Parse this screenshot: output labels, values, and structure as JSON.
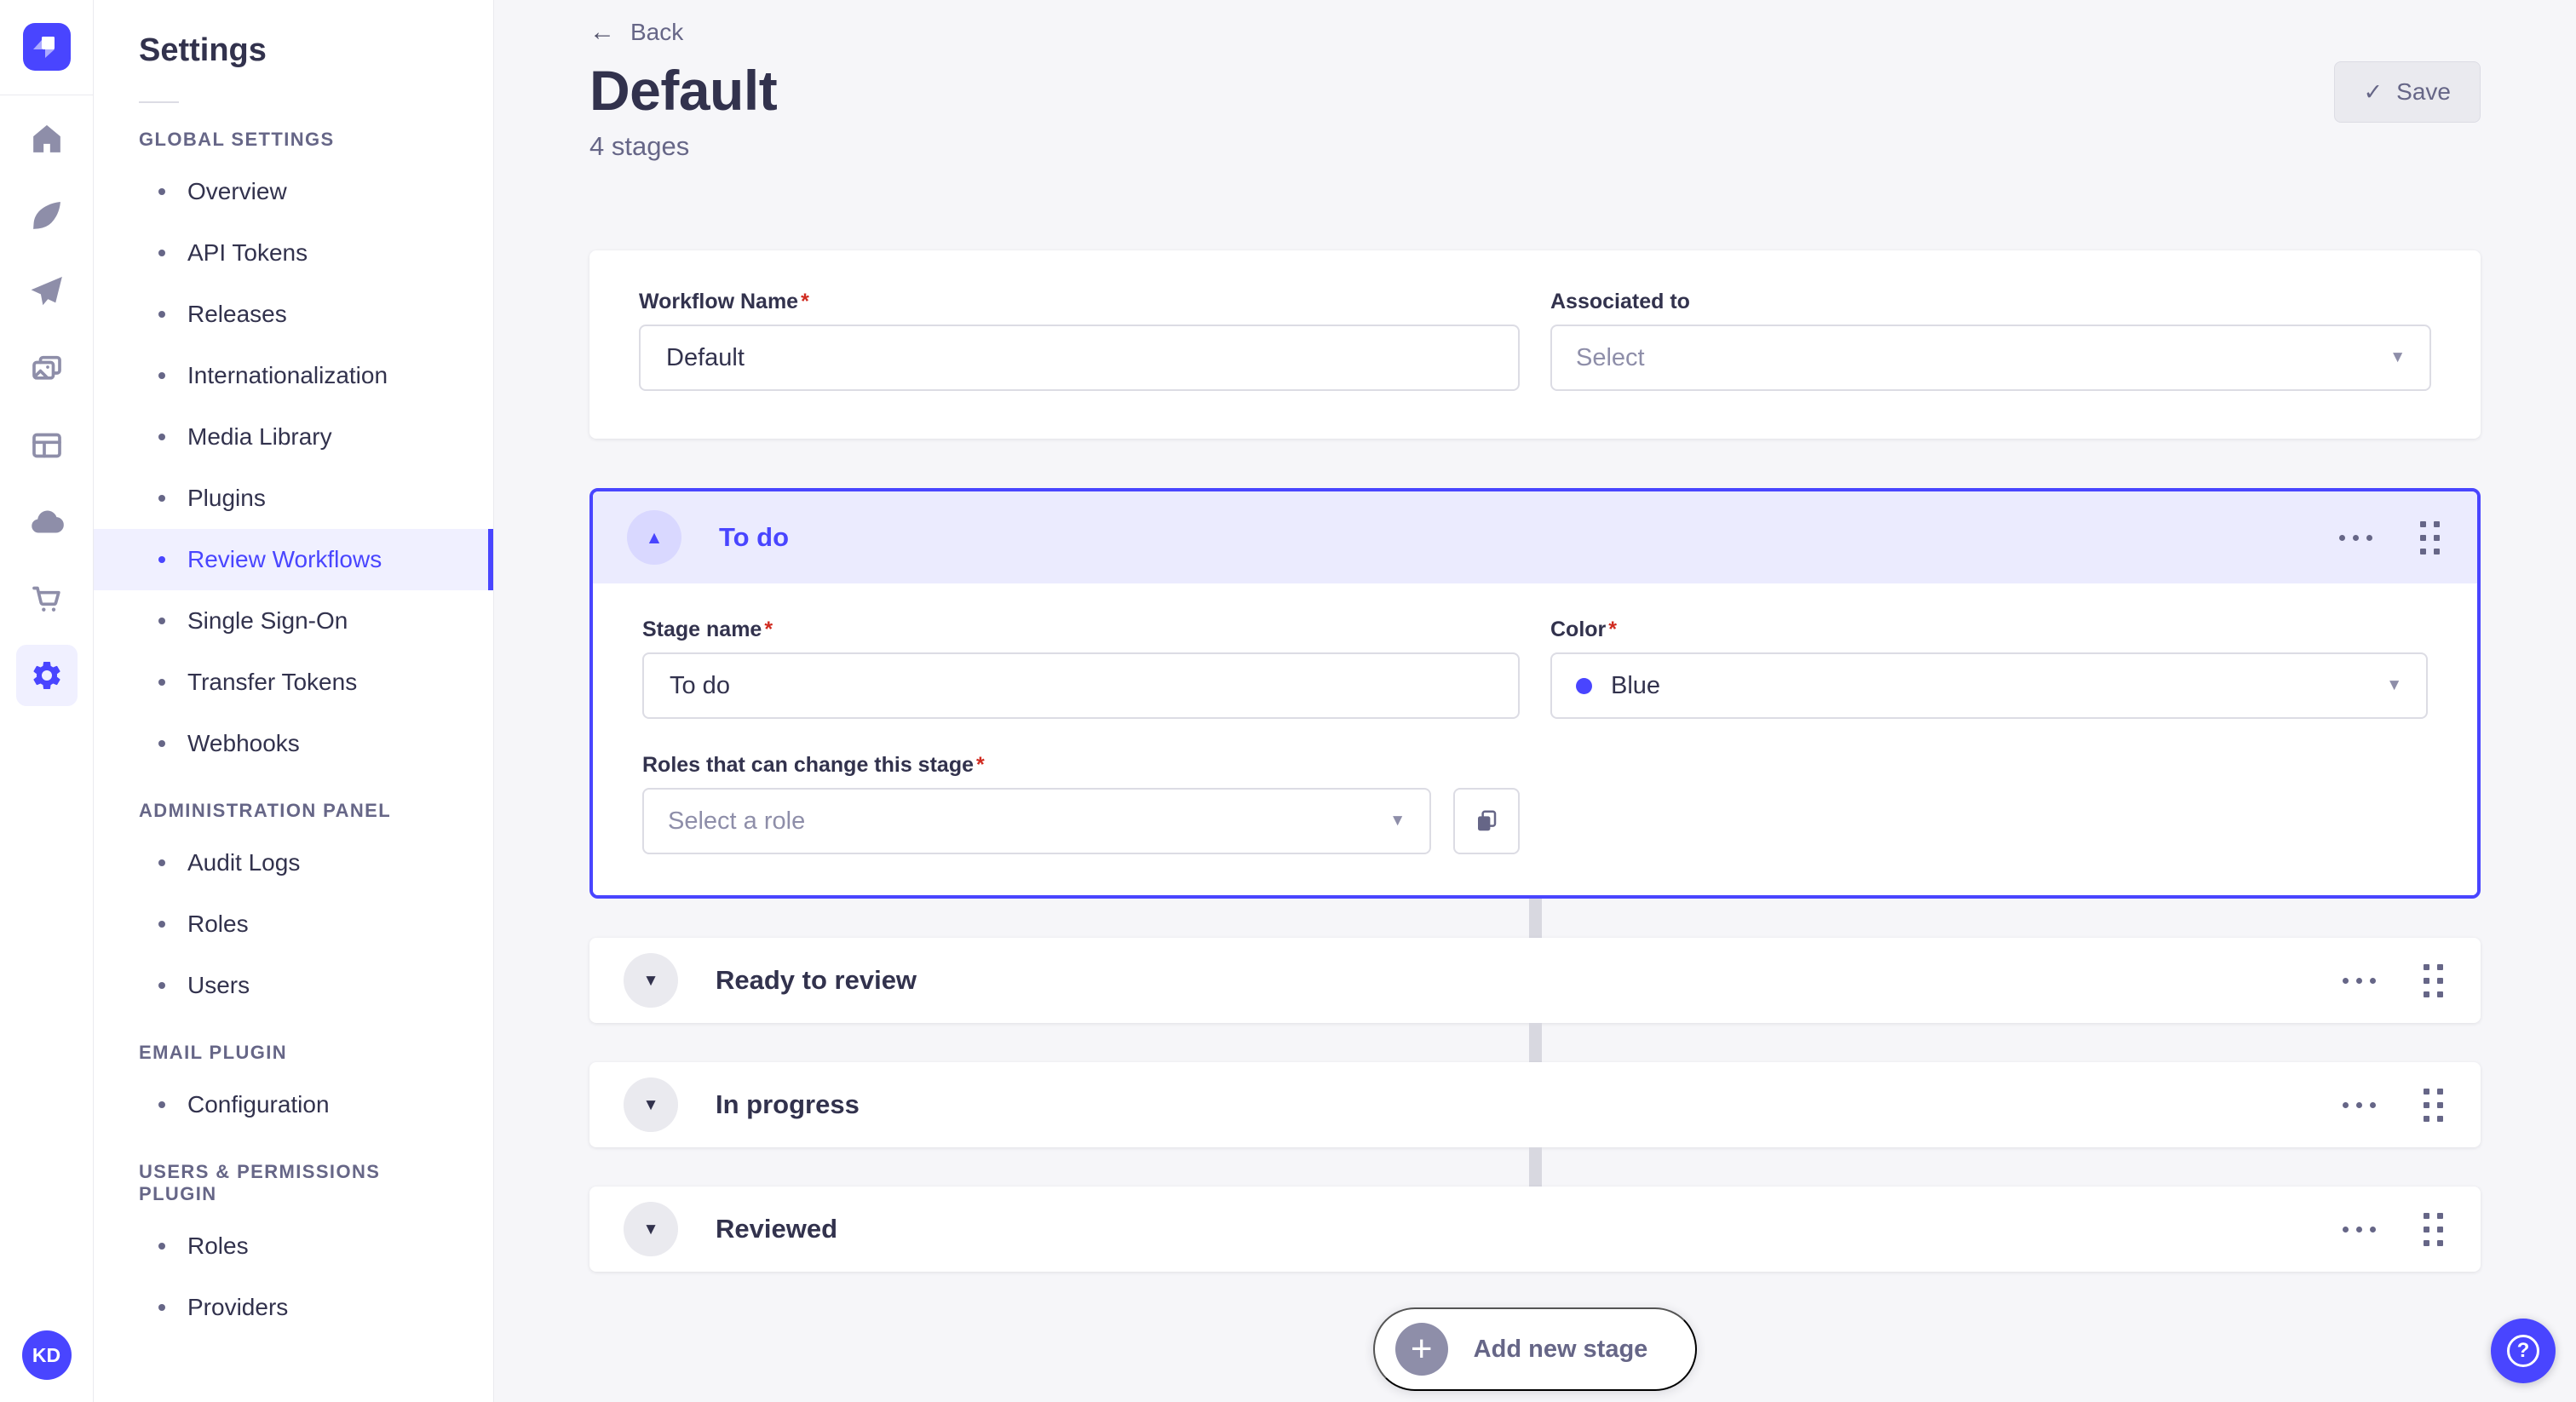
{
  "ui": {
    "required_mark": "*"
  },
  "icons": {
    "back_arrow": "←",
    "check": "✓",
    "caret_down": "▼",
    "collapse_up": "▲",
    "expand_down": "▼",
    "plus": "+",
    "help": "?"
  },
  "nav_rail": {
    "avatar_initials": "KD"
  },
  "sidebar": {
    "title": "Settings",
    "sections": [
      {
        "label": "GLOBAL SETTINGS",
        "items": [
          {
            "label": "Overview"
          },
          {
            "label": "API Tokens"
          },
          {
            "label": "Releases"
          },
          {
            "label": "Internationalization"
          },
          {
            "label": "Media Library"
          },
          {
            "label": "Plugins"
          },
          {
            "label": "Review Workflows",
            "active": true
          },
          {
            "label": "Single Sign-On"
          },
          {
            "label": "Transfer Tokens"
          },
          {
            "label": "Webhooks"
          }
        ]
      },
      {
        "label": "ADMINISTRATION PANEL",
        "items": [
          {
            "label": "Audit Logs"
          },
          {
            "label": "Roles"
          },
          {
            "label": "Users"
          }
        ]
      },
      {
        "label": "EMAIL PLUGIN",
        "items": [
          {
            "label": "Configuration"
          }
        ]
      },
      {
        "label": "USERS & PERMISSIONS PLUGIN",
        "items": [
          {
            "label": "Roles"
          },
          {
            "label": "Providers"
          }
        ]
      }
    ]
  },
  "header": {
    "back_label": "Back",
    "title": "Default",
    "subtitle": "4 stages",
    "save_label": "Save"
  },
  "workflow": {
    "name_label": "Workflow Name",
    "name_value": "Default",
    "associated_label": "Associated to",
    "associated_placeholder": "Select"
  },
  "stage_form": {
    "stage_name_label": "Stage name",
    "stage_name_value": "To do",
    "color_label": "Color",
    "color_value": "Blue",
    "roles_label": "Roles that can change this stage",
    "roles_placeholder": "Select a role"
  },
  "stages": [
    {
      "name": "To do",
      "expanded": true
    },
    {
      "name": "Ready to review",
      "expanded": false
    },
    {
      "name": "In progress",
      "expanded": false
    },
    {
      "name": "Reviewed",
      "expanded": false
    }
  ],
  "footer": {
    "add_stage_label": "Add new stage"
  },
  "colors": {
    "primary": "#4945ff",
    "stage_color_blue": "#4945ff",
    "danger": "#d02b20",
    "main_bg": "#f6f6f9"
  }
}
